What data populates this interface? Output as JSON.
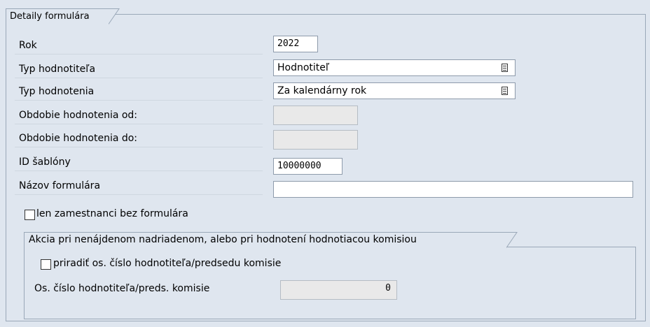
{
  "section": {
    "tab_title": "Detaily formulára"
  },
  "fields": {
    "rok": {
      "label": "Rok",
      "value": "2022"
    },
    "typ_hodnotitela": {
      "label": "Typ hodnotiteľa",
      "value": "Hodnotiteľ"
    },
    "typ_hodnotenia": {
      "label": "Typ hodnotenia",
      "value": "Za kalendárny rok"
    },
    "obdobie_od": {
      "label": "Obdobie hodnotenia od:",
      "value": ""
    },
    "obdobie_do": {
      "label": "Obdobie hodnotenia do:",
      "value": ""
    },
    "id_sablony": {
      "label": "ID šablóny",
      "value": "10000000"
    },
    "nazov_formulara": {
      "label": "Názov formulára",
      "value": ""
    }
  },
  "checkbox_len": {
    "label": "len zamestnanci bez formulára",
    "checked": false
  },
  "group": {
    "title": "Akcia pri nenájdenom nadriadenom, alebo pri hodnotení hodnotiacou komisiou",
    "checkbox": {
      "label": "priradiť os. číslo hodnotiteľa/predsedu komisie",
      "checked": false
    },
    "os_cislo": {
      "label": "Os. číslo hodnotiteľa/preds. komisie",
      "value": "0"
    }
  },
  "icons": {
    "dropdown": "value-help-icon"
  }
}
